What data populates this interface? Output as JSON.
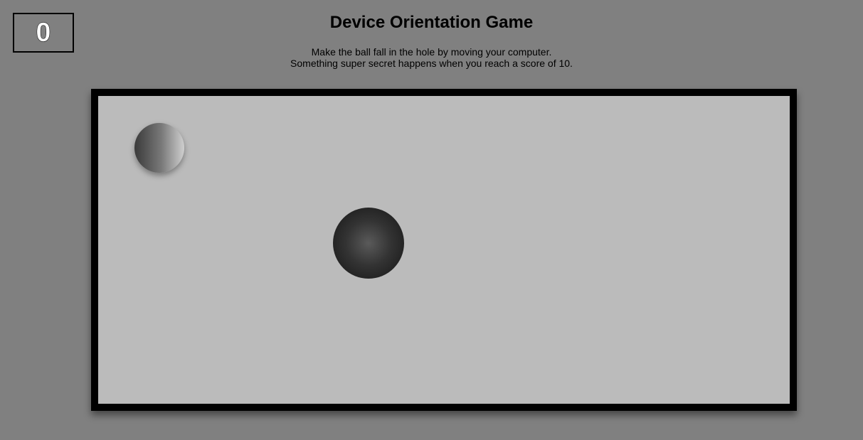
{
  "score": {
    "value": "0"
  },
  "header": {
    "title": "Device Orientation Game",
    "instruction_line_1": "Make the ball fall in the hole by moving your computer.",
    "instruction_line_2": "Something super secret happens when you reach a score of 10."
  },
  "colors": {
    "page_background": "#808080",
    "board_background": "#bbbbbb",
    "board_border": "#000000",
    "score_text": "#ffffff"
  }
}
